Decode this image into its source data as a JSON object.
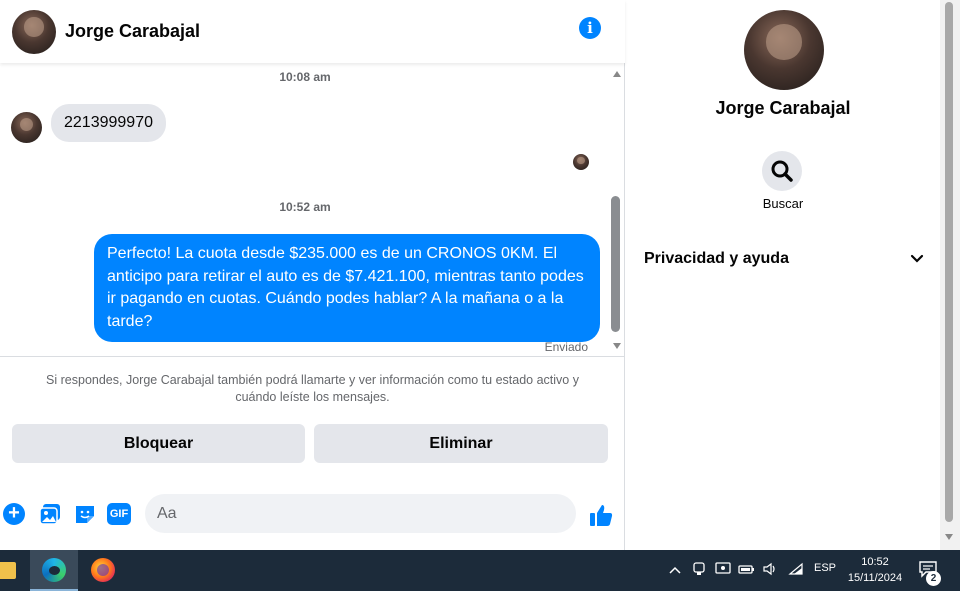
{
  "colors": {
    "accent": "#0084ff",
    "bubble_in": "#e4e6eb",
    "secondary_text": "#65676b",
    "taskbar": "#1c2b3a"
  },
  "header": {
    "contact_name": "Jorge Carabajal",
    "info_icon": "info-icon"
  },
  "messages": {
    "time_1": "10:08 am",
    "incoming_text": "2213999970",
    "time_2": "10:52 am",
    "outgoing_text": "Perfecto! La cuota desde $235.000 es de un CRONOS 0KM. El anticipo para retirar el auto es de $7.421.100, mientras tanto podes ir pagando en cuotas. Cuándo podes hablar? A la mañana o a la tarde?",
    "status": "Enviado"
  },
  "notice": "Si respondes, Jorge Carabajal también podrá llamarte y ver información como tu estado activo y cuándo leíste los mensajes.",
  "actions": {
    "block_label": "Bloquear",
    "delete_label": "Eliminar"
  },
  "composer": {
    "placeholder": "Aa",
    "gif_label": "GIF",
    "icons": [
      "plus-icon",
      "gallery-icon",
      "sticker-icon",
      "gif-icon",
      "emoji-icon",
      "like-icon"
    ]
  },
  "panel": {
    "contact_name": "Jorge Carabajal",
    "search_label": "Buscar",
    "privacy_label": "Privacidad y ayuda"
  },
  "taskbar": {
    "language": "ESP",
    "time": "10:52",
    "date": "15/11/2024",
    "notification_count": "2",
    "apps": [
      "file-explorer-icon",
      "edge-icon",
      "firefox-icon"
    ],
    "tray_icons": [
      "chevron-up-icon",
      "meet-icon",
      "screen-icon",
      "battery-icon",
      "volume-icon",
      "wifi-icon"
    ]
  }
}
